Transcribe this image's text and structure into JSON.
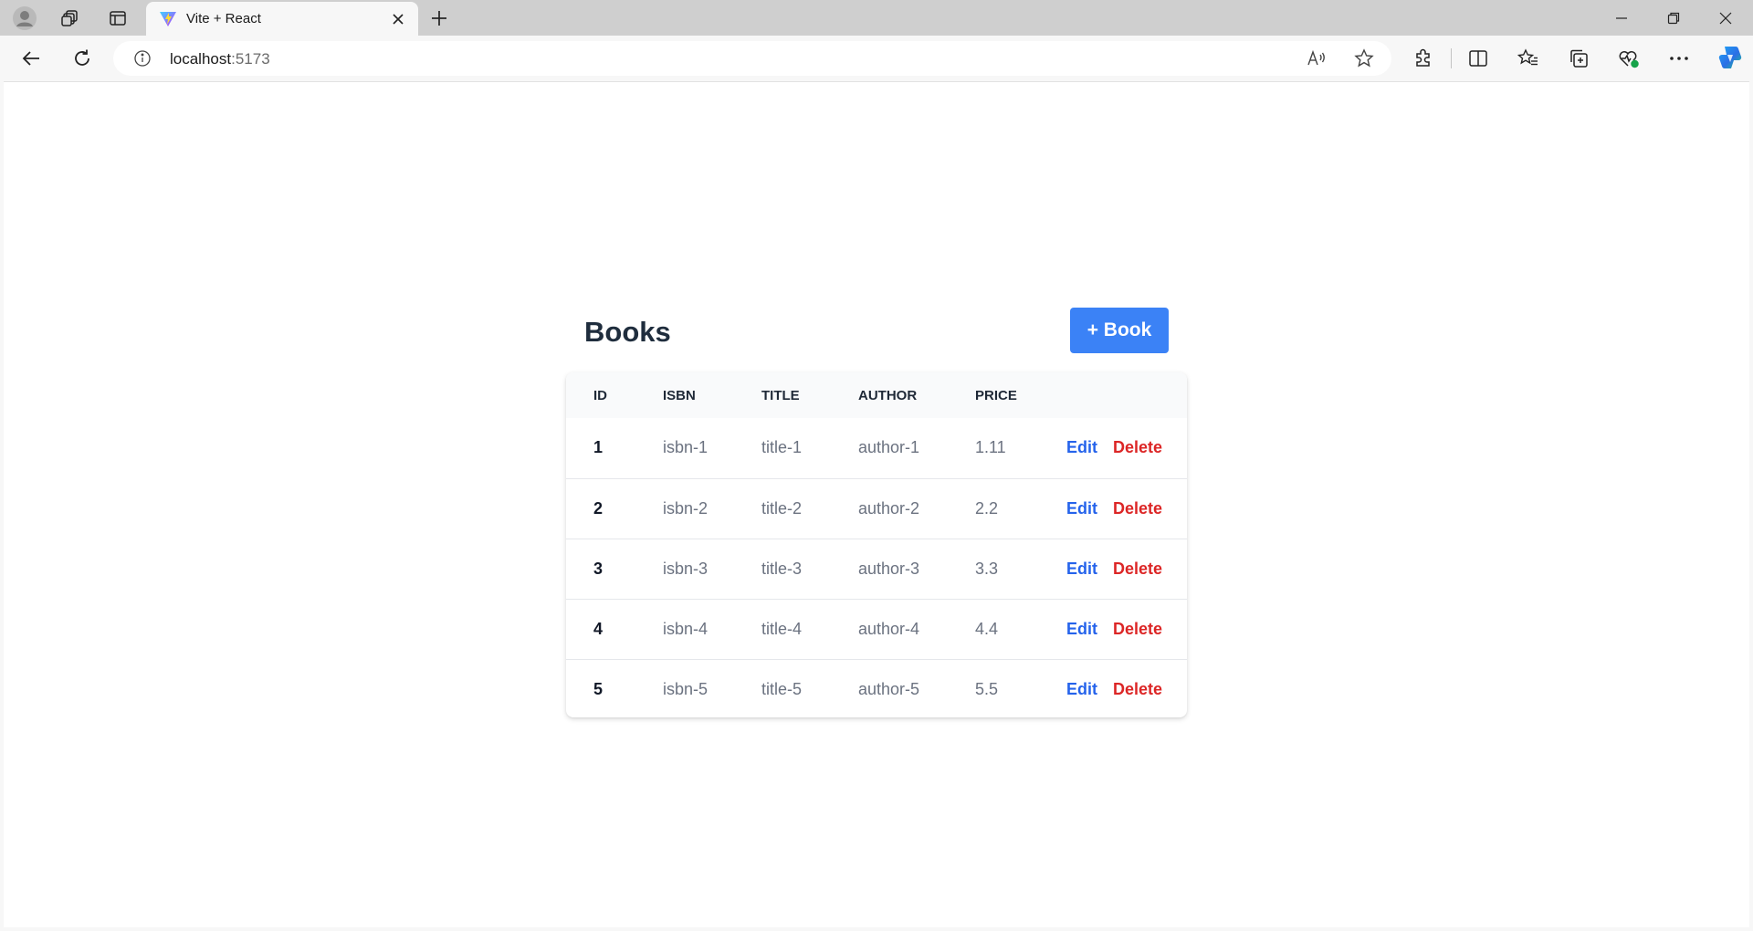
{
  "browser": {
    "tab_title": "Vite + React",
    "url_host": "localhost",
    "url_port": ":5173"
  },
  "page": {
    "title": "Books",
    "add_button_label": "+ Book"
  },
  "table": {
    "headers": [
      "ID",
      "ISBN",
      "TITLE",
      "AUTHOR",
      "PRICE"
    ],
    "rows": [
      {
        "id": "1",
        "isbn": "isbn-1",
        "title": "title-1",
        "author": "author-1",
        "price": "1.11"
      },
      {
        "id": "2",
        "isbn": "isbn-2",
        "title": "title-2",
        "author": "author-2",
        "price": "2.2"
      },
      {
        "id": "3",
        "isbn": "isbn-3",
        "title": "title-3",
        "author": "author-3",
        "price": "3.3"
      },
      {
        "id": "4",
        "isbn": "isbn-4",
        "title": "title-4",
        "author": "author-4",
        "price": "4.4"
      },
      {
        "id": "5",
        "isbn": "isbn-5",
        "title": "title-5",
        "author": "author-5",
        "price": "5.5"
      }
    ],
    "edit_label": "Edit",
    "delete_label": "Delete"
  },
  "colors": {
    "primary": "#3b82f6",
    "edit": "#2563eb",
    "delete": "#dc2626"
  }
}
